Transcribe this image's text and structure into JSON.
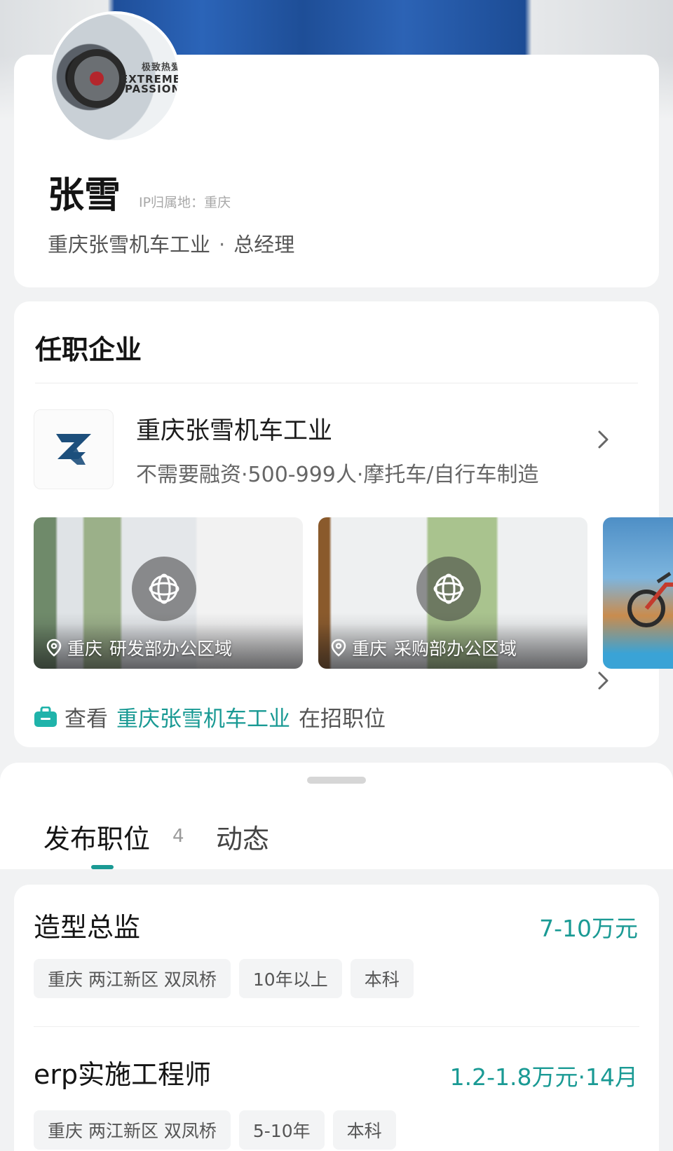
{
  "profile": {
    "name": "张雪",
    "ip_label": "IP归属地：",
    "ip_value": "重庆",
    "company": "重庆张雪机车工业",
    "separator": "·",
    "position": "总经理",
    "avatar_text_cn": "极致热爱",
    "avatar_text_en": "EXTREME PASSION"
  },
  "company_section": {
    "title": "任职企业",
    "company_name": "重庆张雪机车工业",
    "company_meta": "不需要融资·500-999人·摩托车/自行车制造",
    "photos": [
      {
        "city": "重庆",
        "area": "研发部办公区域"
      },
      {
        "city": "重庆",
        "area": "采购部办公区域"
      }
    ],
    "jobs_link": {
      "prefix": "查看",
      "company": "重庆张雪机车工业",
      "suffix": "在招职位"
    }
  },
  "tabs": {
    "jobs_label": "发布职位",
    "jobs_count": "4",
    "feed_label": "动态"
  },
  "jobs": [
    {
      "title": "造型总监",
      "salary": "7-10万元",
      "tags": [
        "重庆 两江新区 双凤桥",
        "10年以上",
        "本科"
      ]
    },
    {
      "title": "erp实施工程师",
      "salary": "1.2-1.8万元·14月",
      "tags": [
        "重庆 两江新区 双凤桥",
        "5-10年",
        "本科"
      ]
    }
  ],
  "colors": {
    "accent": "#1a9a94",
    "logo_blue": "#1d4f7c"
  },
  "icons": [
    "chevron-right-icon",
    "map-pin-icon",
    "vr-panorama-icon",
    "briefcase-icon",
    "company-logo-icon"
  ]
}
